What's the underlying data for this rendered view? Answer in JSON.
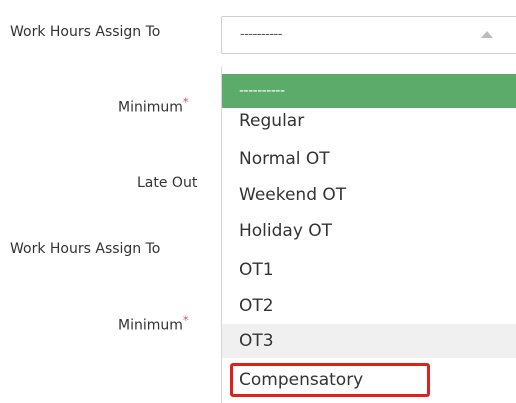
{
  "form": {
    "work_hours_label_1": "Work Hours Assign To",
    "minimum_label_1": "Minimum",
    "late_out_label": "Late Out",
    "work_hours_label_2": "Work Hours Assign To",
    "minimum_label_2": "Minimum",
    "required_mark": "*"
  },
  "select": {
    "value": "----------",
    "arrow_icon": "caret-up-icon",
    "options": [
      "----------",
      "Regular",
      "Normal OT",
      "Weekend OT",
      "Holiday OT",
      "OT1",
      "OT2",
      "OT3",
      "Compensatory"
    ],
    "selected_index": 0,
    "hovered_index": 7
  },
  "annotation": {
    "highlight_color": "#e0201a",
    "highlighted_option": "Compensatory"
  },
  "colors": {
    "selected_background": "#5cab6a",
    "hover_background": "#f0f0f0",
    "required": "#d9534f"
  }
}
